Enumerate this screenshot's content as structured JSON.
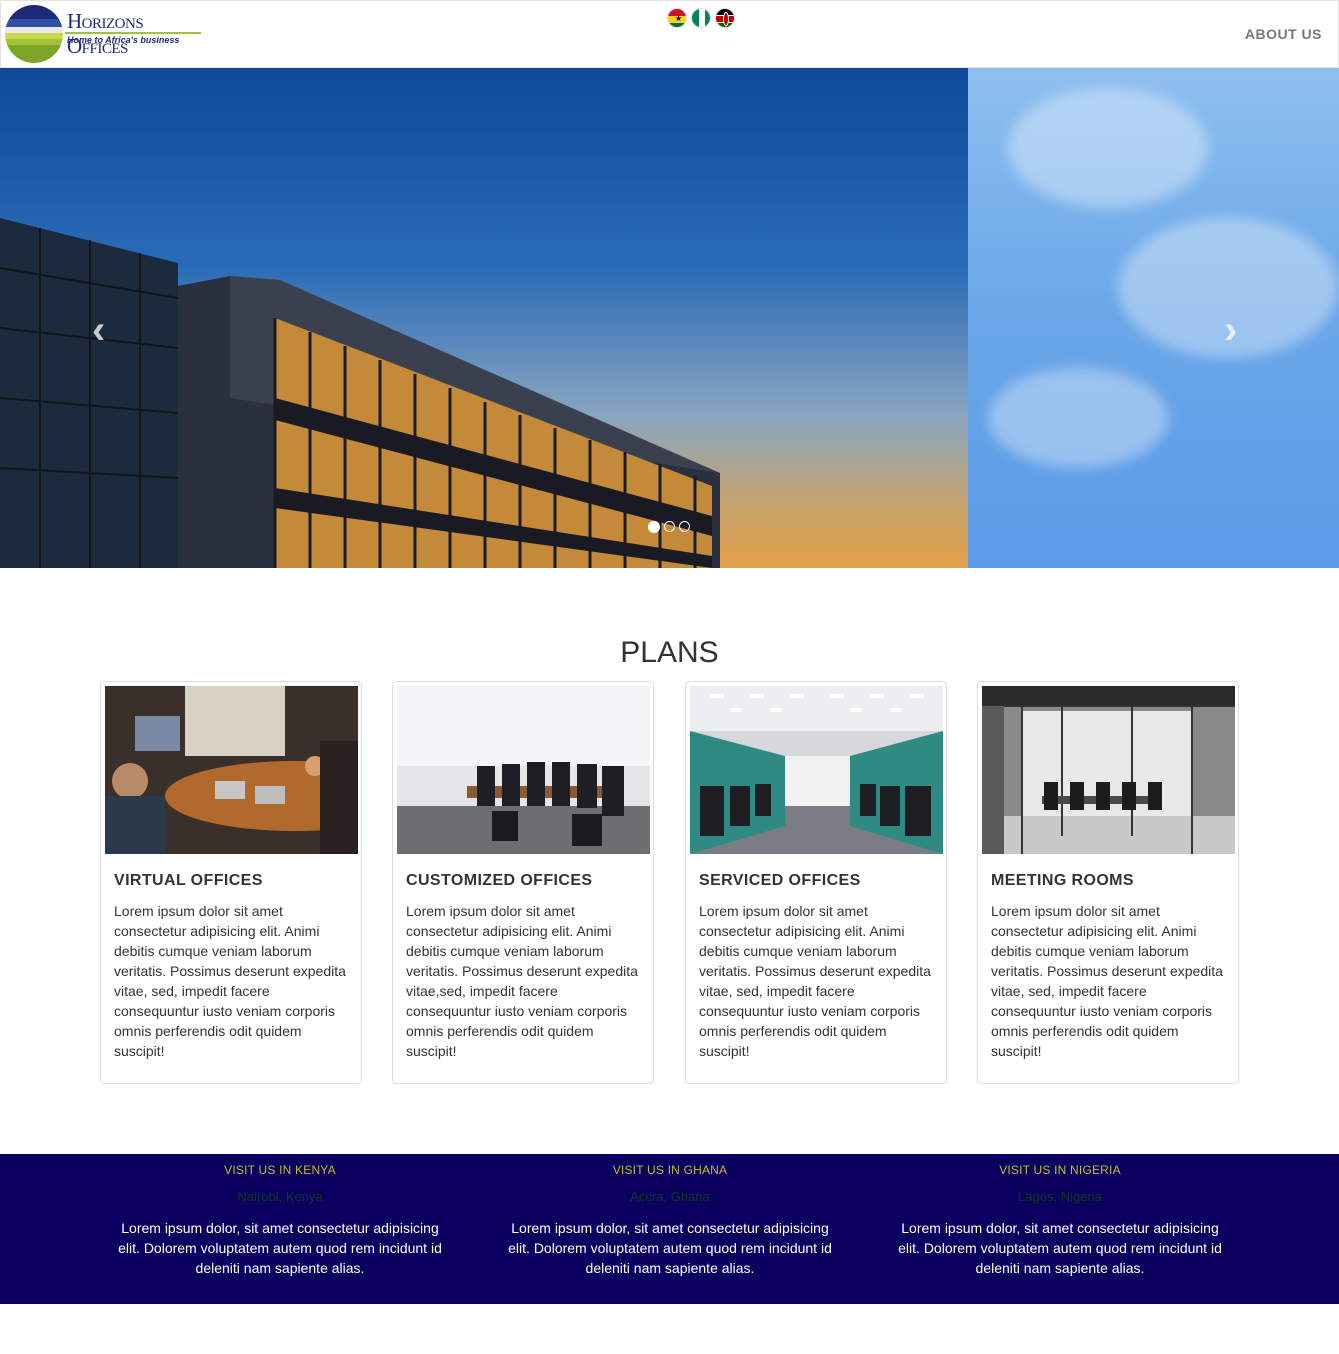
{
  "header": {
    "logo_title": "Horizons Offices",
    "logo_tagline": "Home to Africa's business",
    "flags": [
      "ghana-flag",
      "nigeria-flag",
      "kenya-flag"
    ],
    "nav_about": "ABOUT US"
  },
  "carousel": {
    "slide_count": 3,
    "active_index": 0,
    "prev_symbol": "‹",
    "next_symbol": "›"
  },
  "plans": {
    "title": "PLANS",
    "cards": [
      {
        "title": "VIRTUAL OFFICES",
        "text": "Lorem ipsum dolor sit amet consectetur adipisicing elit. Animi debitis cumque veniam laborum veritatis. Possimus deserunt expedita vitae, sed, impedit facere consequuntur iusto veniam corporis omnis perferendis odit quidem suscipit!"
      },
      {
        "title": "CUSTOMIZED OFFICES",
        "text": "Lorem ipsum dolor sit amet consectetur adipisicing elit. Animi debitis cumque veniam laborum veritatis. Possimus deserunt expedita vitae,sed, impedit facere consequuntur iusto veniam corporis omnis perferendis odit quidem suscipit!"
      },
      {
        "title": "SERVICED OFFICES",
        "text": "Lorem ipsum dolor sit amet consectetur adipisicing elit. Animi debitis cumque veniam laborum veritatis. Possimus deserunt expedita vitae, sed, impedit facere consequuntur iusto veniam corporis omnis perferendis odit quidem suscipit!"
      },
      {
        "title": "MEETING ROOMS",
        "text": "Lorem ipsum dolor sit amet consectetur adipisicing elit. Animi debitis cumque veniam laborum veritatis. Possimus deserunt expedita vitae, sed, impedit facere consequuntur iusto veniam corporis omnis perferendis odit quidem suscipit!"
      }
    ]
  },
  "footer": {
    "columns": [
      {
        "title": "VISIT US IN KENYA",
        "city": "Nairobi, Kenya",
        "text": "Lorem ipsum dolor, sit amet consectetur adipisicing elit. Dolorem voluptatem autem quod rem incidunt id deleniti nam sapiente alias."
      },
      {
        "title": "VISIT US IN GHANA",
        "city": "Accra, Ghana",
        "text": "Lorem ipsum dolor, sit amet consectetur adipisicing elit. Dolorem voluptatem autem quod rem incidunt id deleniti nam sapiente alias."
      },
      {
        "title": "VISIT US IN NIGERIA",
        "city": "Lagos, Nigeria",
        "text": "Lorem ipsum dolor, sit amet consectetur adipisicing elit. Dolorem voluptatem autem quod rem incidunt id deleniti nam sapiente alias."
      }
    ]
  },
  "colors": {
    "footer_bg": "#0b0060",
    "footer_heading": "#c9b92f",
    "brand_navy": "#1e2a78",
    "brand_green": "#a4c13b"
  }
}
